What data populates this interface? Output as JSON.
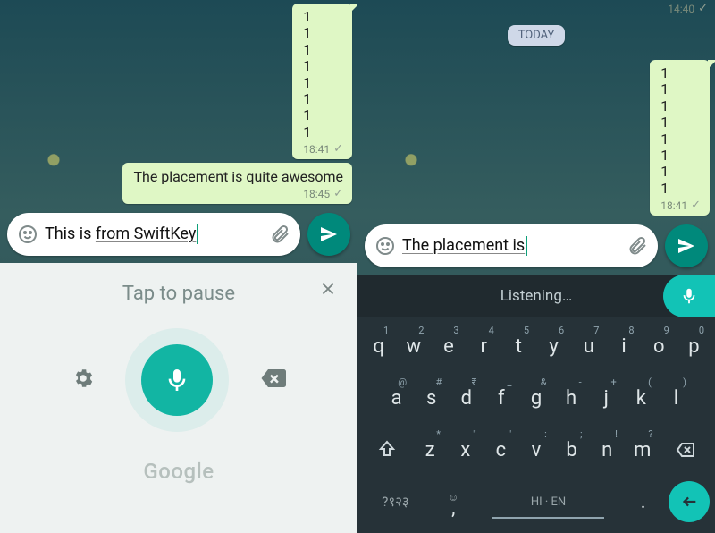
{
  "left": {
    "messages": {
      "stack": [
        "1",
        "1",
        "1",
        "1",
        "1",
        "1",
        "1",
        "1"
      ],
      "stack_time": "18:41",
      "msg2_text": "The placement is quite awesome",
      "msg2_time": "18:45"
    },
    "input": {
      "text_plain": "This is ",
      "text_underlined": "from SwiftKey"
    },
    "voice_panel": {
      "prompt": "Tap to pause",
      "brand": "Google"
    }
  },
  "right": {
    "top_time": "14:40",
    "today_label": "TODAY",
    "messages": {
      "stack": [
        "1",
        "1",
        "1",
        "1",
        "1",
        "1",
        "1",
        "1"
      ],
      "stack_time": "18:41"
    },
    "input": {
      "text_underlined": "The placement is"
    },
    "keyboard": {
      "listening": "Listening…",
      "row1": [
        {
          "k": "q",
          "s": "1"
        },
        {
          "k": "w",
          "s": "2"
        },
        {
          "k": "e",
          "s": "3"
        },
        {
          "k": "r",
          "s": "4"
        },
        {
          "k": "t",
          "s": "5"
        },
        {
          "k": "y",
          "s": "6"
        },
        {
          "k": "u",
          "s": "7"
        },
        {
          "k": "i",
          "s": "8"
        },
        {
          "k": "o",
          "s": "9"
        },
        {
          "k": "p",
          "s": "0"
        }
      ],
      "row2": [
        {
          "k": "a",
          "s": "@"
        },
        {
          "k": "s",
          "s": "#"
        },
        {
          "k": "d",
          "s": "₹"
        },
        {
          "k": "f",
          "s": "_"
        },
        {
          "k": "g",
          "s": "&"
        },
        {
          "k": "h",
          "s": "-"
        },
        {
          "k": "j",
          "s": "+"
        },
        {
          "k": "k",
          "s": "("
        },
        {
          "k": "l",
          "s": ")"
        }
      ],
      "row3": [
        {
          "k": "z",
          "s": "*"
        },
        {
          "k": "x",
          "s": "\""
        },
        {
          "k": "c",
          "s": "'"
        },
        {
          "k": "v",
          "s": ":"
        },
        {
          "k": "b",
          "s": ";"
        },
        {
          "k": "n",
          "s": "!"
        },
        {
          "k": "m",
          "s": "?"
        }
      ],
      "lang_key": "?१२३",
      "space_label": "HI · EN"
    }
  }
}
